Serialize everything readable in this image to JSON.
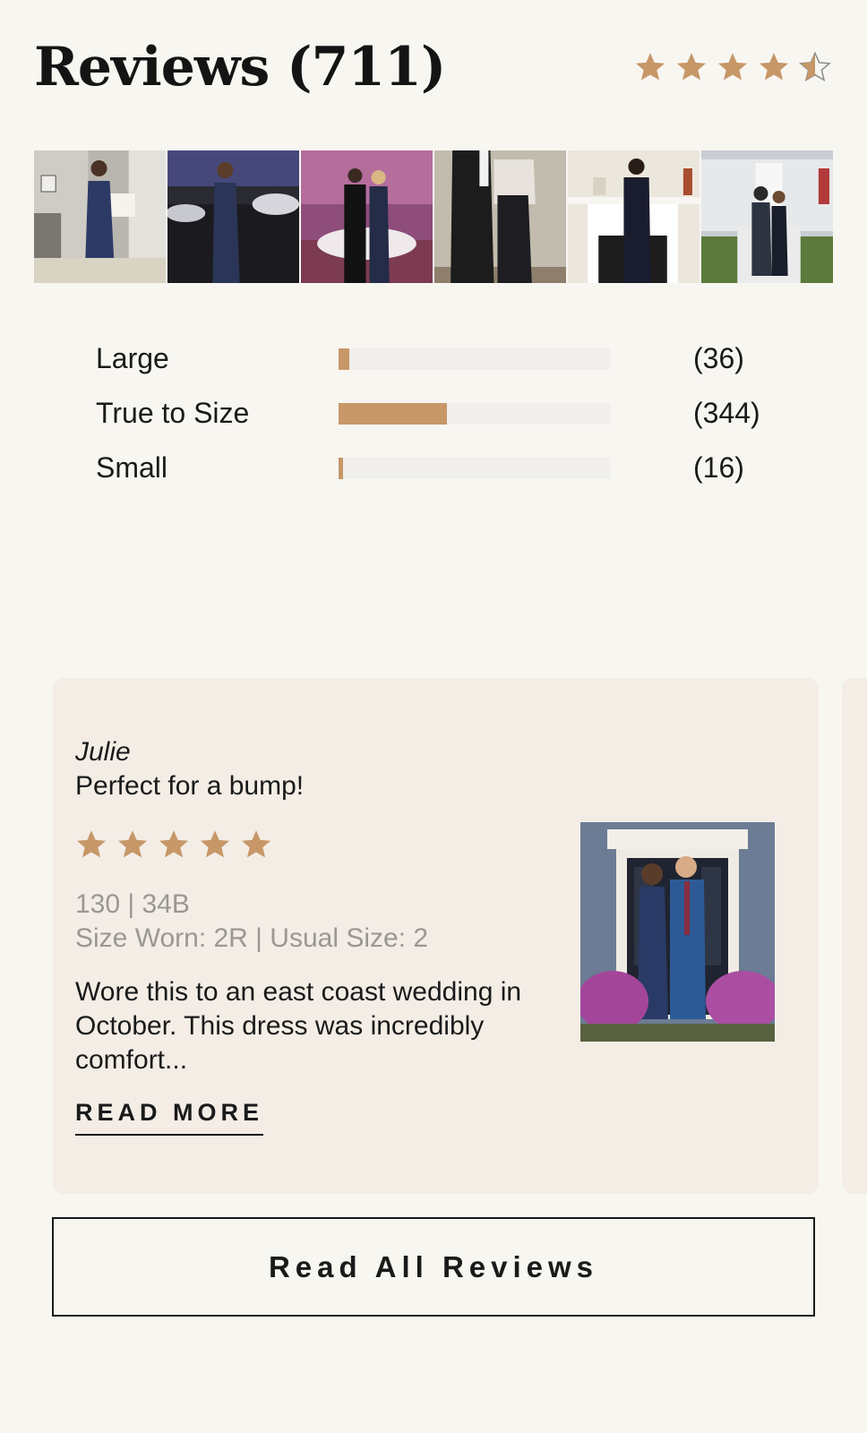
{
  "header": {
    "title": "Reviews (711)",
    "average_rating": 4.5,
    "rating_max": 5
  },
  "photos": [
    {
      "icon": "review-photo-1"
    },
    {
      "icon": "review-photo-2"
    },
    {
      "icon": "review-photo-3"
    },
    {
      "icon": "review-photo-4"
    },
    {
      "icon": "review-photo-5"
    },
    {
      "icon": "review-photo-6"
    }
  ],
  "fit": {
    "rows": [
      {
        "label": "Large",
        "count": "(36)",
        "fraction": 0.04
      },
      {
        "label": "True to Size",
        "count": "(344)",
        "fraction": 0.4
      },
      {
        "label": "Small",
        "count": "(16)",
        "fraction": 0.017
      }
    ]
  },
  "review": {
    "reviewer": "Julie",
    "headline": "Perfect for a bump!",
    "rating": 5,
    "meta_line1": "130 | 34B",
    "meta_line2": "Size Worn: 2R | Usual Size: 2",
    "body": "Wore this to an east coast wedding in October. This dress was incredibly comfort...",
    "read_more_label": "READ MORE"
  },
  "read_all_label": "Read All Reviews",
  "colors": {
    "accent": "#c79768",
    "background": "#f8f6f1",
    "card": "#f3ede6"
  }
}
